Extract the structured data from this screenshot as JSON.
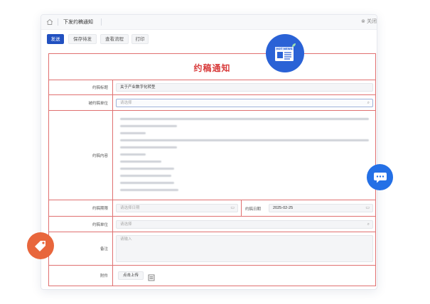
{
  "tabbar": {
    "title": "下发约稿通知",
    "close_label": "关闭"
  },
  "toolbar": {
    "send": "发送",
    "save_draft": "保存待发",
    "view_flow": "查看流程",
    "print": "打印"
  },
  "form": {
    "title": "约稿通知",
    "fields": {
      "topic": {
        "label": "约稿标题",
        "value": "关于产业数字化转型"
      },
      "recipient": {
        "label": "被约稿单位",
        "placeholder": "请选择"
      },
      "content": {
        "label": "约稿内容"
      },
      "deadline": {
        "label": "约稿期限",
        "placeholder": "请选择日期"
      },
      "issue_date": {
        "label": "约稿日期",
        "value": "2025-02-25"
      },
      "unit": {
        "label": "约稿单位",
        "placeholder": "请选择"
      },
      "remark": {
        "label": "备注",
        "placeholder": "请输入"
      },
      "attachment": {
        "label": "附件",
        "upload_label": "点击上传"
      }
    }
  },
  "badges": {
    "news_text": "HOT NEWS"
  },
  "colors": {
    "primary": "#2150c0",
    "title_red": "#d83b3b",
    "grid_red": "#e07070",
    "news_blue": "#2a62d6",
    "chat_blue": "#2470e6",
    "tag_orange": "#e8663c"
  }
}
